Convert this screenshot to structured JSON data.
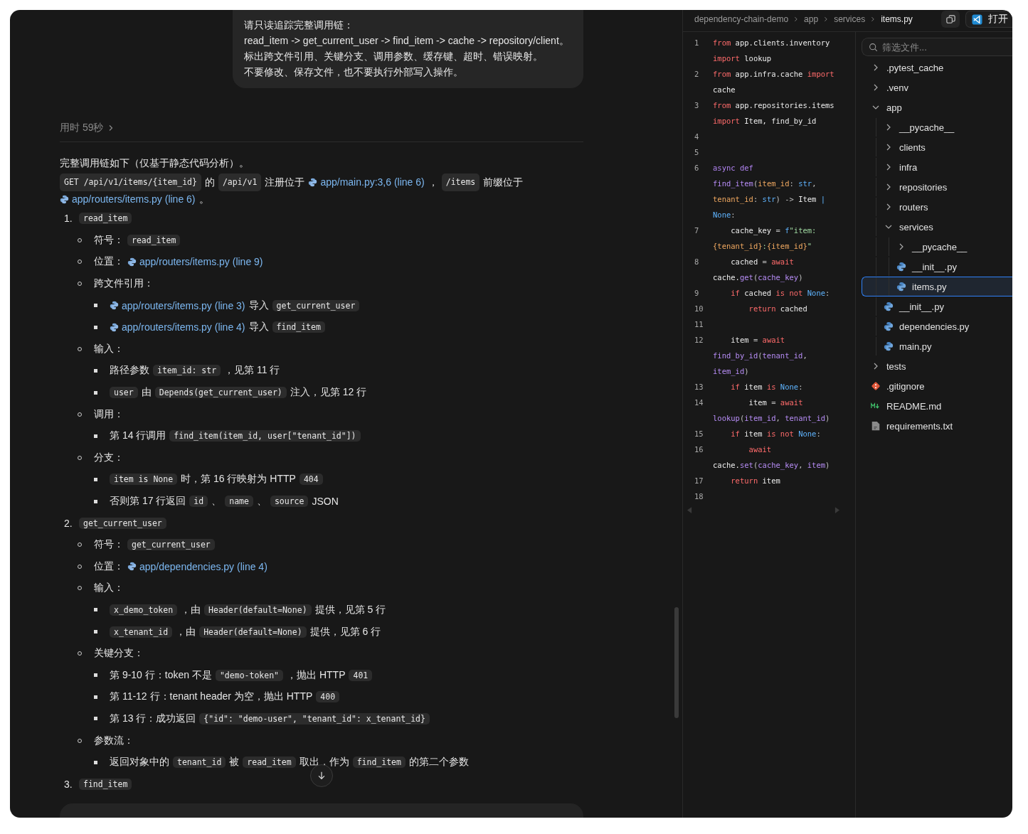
{
  "chat": {
    "user_message": [
      "请只读追踪完整调用链：",
      "read_item -> get_current_user -> find_item -> cache -> repository/client。",
      "标出跨文件引用、关键分支、调用参数、缓存键、超时、错误映射。",
      "不要修改、保存文件，也不要执行外部写入操作。"
    ],
    "elapsed": "用时 59秒",
    "intro": "完整调用链如下（仅基于静态代码分析）。",
    "summary": [
      {
        "kind": "code",
        "text": "GET /api/v1/items/{item_id}"
      },
      {
        "kind": "text",
        "text": "的"
      },
      {
        "kind": "code",
        "text": "/api/v1"
      },
      {
        "kind": "text",
        "text": "注册位于"
      },
      {
        "kind": "link",
        "text": "app/main.py:3,6 (line 6)"
      },
      {
        "kind": "text",
        "text": "，"
      },
      {
        "kind": "code",
        "text": "/items"
      },
      {
        "kind": "text",
        "text": "前缀位于"
      },
      {
        "kind": "link",
        "text": "app/routers/items.py (line 6)"
      },
      {
        "kind": "text",
        "text": "。"
      }
    ],
    "steps": [
      {
        "number": "1.",
        "name": "read_item",
        "items": [
          {
            "segments": [
              {
                "kind": "text",
                "text": "符号："
              },
              {
                "kind": "code",
                "text": "read_item"
              }
            ]
          },
          {
            "segments": [
              {
                "kind": "text",
                "text": "位置："
              },
              {
                "kind": "link",
                "text": "app/routers/items.py (line 9)"
              }
            ]
          },
          {
            "segments": [
              {
                "kind": "text",
                "text": "跨文件引用："
              }
            ],
            "children": [
              {
                "segments": [
                  {
                    "kind": "link",
                    "text": "app/routers/items.py (line 3)"
                  },
                  {
                    "kind": "text",
                    "text": "导入"
                  },
                  {
                    "kind": "code",
                    "text": "get_current_user"
                  }
                ]
              },
              {
                "segments": [
                  {
                    "kind": "link",
                    "text": "app/routers/items.py (line 4)"
                  },
                  {
                    "kind": "text",
                    "text": "导入"
                  },
                  {
                    "kind": "code",
                    "text": "find_item"
                  }
                ]
              }
            ]
          },
          {
            "segments": [
              {
                "kind": "text",
                "text": "输入："
              }
            ],
            "children": [
              {
                "segments": [
                  {
                    "kind": "text",
                    "text": "路径参数"
                  },
                  {
                    "kind": "code",
                    "text": "item_id: str"
                  },
                  {
                    "kind": "text",
                    "text": "，见第 11 行"
                  }
                ]
              },
              {
                "segments": [
                  {
                    "kind": "code",
                    "text": "user"
                  },
                  {
                    "kind": "text",
                    "text": "由"
                  },
                  {
                    "kind": "code",
                    "text": "Depends(get_current_user)"
                  },
                  {
                    "kind": "text",
                    "text": "注入，见第 12 行"
                  }
                ]
              }
            ]
          },
          {
            "segments": [
              {
                "kind": "text",
                "text": "调用："
              }
            ],
            "children": [
              {
                "segments": [
                  {
                    "kind": "text",
                    "text": "第 14 行调用"
                  },
                  {
                    "kind": "code",
                    "text": "find_item(item_id, user[\"tenant_id\"])"
                  }
                ]
              }
            ]
          },
          {
            "segments": [
              {
                "kind": "text",
                "text": "分支："
              }
            ],
            "children": [
              {
                "segments": [
                  {
                    "kind": "code",
                    "text": "item is None"
                  },
                  {
                    "kind": "text",
                    "text": "时，第 16 行映射为 HTTP"
                  },
                  {
                    "kind": "code",
                    "text": "404"
                  }
                ]
              },
              {
                "segments": [
                  {
                    "kind": "text",
                    "text": "否则第 17 行返回"
                  },
                  {
                    "kind": "code",
                    "text": "id"
                  },
                  {
                    "kind": "text",
                    "text": "、"
                  },
                  {
                    "kind": "code",
                    "text": "name"
                  },
                  {
                    "kind": "text",
                    "text": "、"
                  },
                  {
                    "kind": "code",
                    "text": "source"
                  },
                  {
                    "kind": "text",
                    "text": "JSON"
                  }
                ]
              }
            ]
          }
        ]
      },
      {
        "number": "2.",
        "name": "get_current_user",
        "items": [
          {
            "segments": [
              {
                "kind": "text",
                "text": "符号："
              },
              {
                "kind": "code",
                "text": "get_current_user"
              }
            ]
          },
          {
            "segments": [
              {
                "kind": "text",
                "text": "位置："
              },
              {
                "kind": "link",
                "text": "app/dependencies.py (line 4)"
              }
            ]
          },
          {
            "segments": [
              {
                "kind": "text",
                "text": "输入："
              }
            ],
            "children": [
              {
                "segments": [
                  {
                    "kind": "code",
                    "text": "x_demo_token"
                  },
                  {
                    "kind": "text",
                    "text": "，由"
                  },
                  {
                    "kind": "code",
                    "text": "Header(default=None)"
                  },
                  {
                    "kind": "text",
                    "text": "提供，见第 5 行"
                  }
                ]
              },
              {
                "segments": [
                  {
                    "kind": "code",
                    "text": "x_tenant_id"
                  },
                  {
                    "kind": "text",
                    "text": "，由"
                  },
                  {
                    "kind": "code",
                    "text": "Header(default=None)"
                  },
                  {
                    "kind": "text",
                    "text": "提供，见第 6 行"
                  }
                ]
              }
            ]
          },
          {
            "segments": [
              {
                "kind": "text",
                "text": "关键分支："
              }
            ],
            "children": [
              {
                "segments": [
                  {
                    "kind": "text",
                    "text": "第 9-10 行：token 不是"
                  },
                  {
                    "kind": "code",
                    "text": "\"demo-token\""
                  },
                  {
                    "kind": "text",
                    "text": "，抛出 HTTP"
                  },
                  {
                    "kind": "code",
                    "text": "401"
                  }
                ]
              },
              {
                "segments": [
                  {
                    "kind": "text",
                    "text": "第 11-12 行：tenant header 为空，抛出 HTTP"
                  },
                  {
                    "kind": "code",
                    "text": "400"
                  }
                ]
              },
              {
                "segments": [
                  {
                    "kind": "text",
                    "text": "第 13 行：成功返回"
                  },
                  {
                    "kind": "code",
                    "text": "{\"id\": \"demo-user\", \"tenant_id\": x_tenant_id}"
                  }
                ]
              }
            ]
          },
          {
            "segments": [
              {
                "kind": "text",
                "text": "参数流："
              }
            ],
            "children": [
              {
                "segments": [
                  {
                    "kind": "text",
                    "text": "返回对象中的"
                  },
                  {
                    "kind": "code",
                    "text": "tenant_id"
                  },
                  {
                    "kind": "text",
                    "text": "被"
                  },
                  {
                    "kind": "code",
                    "text": "read_item"
                  },
                  {
                    "kind": "text",
                    "text": "取出，作为"
                  },
                  {
                    "kind": "code",
                    "text": "find_item"
                  },
                  {
                    "kind": "text",
                    "text": "的第二个参数"
                  }
                ]
              }
            ]
          }
        ]
      },
      {
        "number": "3.",
        "name": "find_item"
      }
    ]
  },
  "editor": {
    "breadcrumb": [
      "dependency-chain-demo",
      "app",
      "services",
      "items.py"
    ],
    "open_button": "打开",
    "lines": [
      {
        "number": "1",
        "rows": [
          {
            "tokens": [
              {
                "kind": "kw",
                "text": "from"
              },
              {
                "kind": "plain",
                "text": " app.clients.inventory"
              }
            ]
          },
          {
            "tokens": [
              {
                "kind": "kw",
                "text": "import"
              },
              {
                "kind": "plain",
                "text": " lookup"
              }
            ]
          }
        ]
      },
      {
        "number": "2",
        "rows": [
          {
            "tokens": [
              {
                "kind": "kw",
                "text": "from"
              },
              {
                "kind": "plain",
                "text": " app.infra.cache "
              },
              {
                "kind": "kw",
                "text": "import"
              }
            ]
          },
          {
            "tokens": [
              {
                "kind": "plain",
                "text": "cache"
              }
            ]
          }
        ]
      },
      {
        "number": "3",
        "rows": [
          {
            "tokens": [
              {
                "kind": "kw",
                "text": "from"
              },
              {
                "kind": "plain",
                "text": " app.repositories.items"
              }
            ]
          },
          {
            "tokens": [
              {
                "kind": "kw",
                "text": "import"
              },
              {
                "kind": "plain",
                "text": " Item, find_by_id"
              }
            ]
          }
        ]
      },
      {
        "number": "4"
      },
      {
        "number": "5"
      },
      {
        "number": "6",
        "rows": [
          {
            "tokens": [
              {
                "kind": "decl",
                "text": "async def"
              }
            ]
          },
          {
            "tokens": [
              {
                "kind": "fn",
                "text": "find_item"
              },
              {
                "kind": "punct",
                "text": "("
              },
              {
                "kind": "param",
                "text": "item_id"
              },
              {
                "kind": "punct",
                "text": ": "
              },
              {
                "kind": "type",
                "text": "str"
              },
              {
                "kind": "punct",
                "text": ","
              }
            ]
          },
          {
            "tokens": [
              {
                "kind": "param",
                "text": "tenant_id"
              },
              {
                "kind": "punct",
                "text": ": "
              },
              {
                "kind": "type",
                "text": "str"
              },
              {
                "kind": "punct",
                "text": ") -> "
              },
              {
                "kind": "plain",
                "text": "Item"
              },
              {
                "kind": "type",
                "text": " |"
              }
            ]
          },
          {
            "tokens": [
              {
                "kind": "type",
                "text": "None"
              },
              {
                "kind": "punct",
                "text": ":"
              }
            ]
          }
        ]
      },
      {
        "number": "7",
        "rows": [
          {
            "tokens": [
              {
                "kind": "plain",
                "text": "    cache_key "
              },
              {
                "kind": "punct",
                "text": "= "
              },
              {
                "kind": "type",
                "text": "f"
              },
              {
                "kind": "str",
                "text": "\"item:"
              }
            ]
          },
          {
            "tokens": [
              {
                "kind": "param",
                "text": "{tenant_id}"
              },
              {
                "kind": "str",
                "text": ":"
              },
              {
                "kind": "param",
                "text": "{item_id}"
              },
              {
                "kind": "str",
                "text": "\""
              }
            ]
          }
        ]
      },
      {
        "number": "8",
        "rows": [
          {
            "tokens": [
              {
                "kind": "plain",
                "text": "    cached "
              },
              {
                "kind": "punct",
                "text": "= "
              },
              {
                "kind": "kw",
                "text": "await"
              }
            ]
          },
          {
            "tokens": [
              {
                "kind": "plain",
                "text": "cache."
              },
              {
                "kind": "fn",
                "text": "get"
              },
              {
                "kind": "punct",
                "text": "("
              },
              {
                "kind": "fn",
                "text": "cache_key"
              },
              {
                "kind": "punct",
                "text": ")"
              }
            ]
          }
        ]
      },
      {
        "number": "9",
        "rows": [
          {
            "tokens": [
              {
                "kind": "kw",
                "text": "    if"
              },
              {
                "kind": "plain",
                "text": " cached "
              },
              {
                "kind": "kw",
                "text": "is not"
              },
              {
                "kind": "type",
                "text": " None"
              },
              {
                "kind": "punct",
                "text": ":"
              }
            ]
          }
        ]
      },
      {
        "number": "10",
        "rows": [
          {
            "tokens": [
              {
                "kind": "kw",
                "text": "        return"
              },
              {
                "kind": "plain",
                "text": " cached"
              }
            ]
          }
        ]
      },
      {
        "number": "11"
      },
      {
        "number": "12",
        "rows": [
          {
            "tokens": [
              {
                "kind": "plain",
                "text": "    item "
              },
              {
                "kind": "punct",
                "text": "= "
              },
              {
                "kind": "kw",
                "text": "await"
              }
            ]
          },
          {
            "tokens": [
              {
                "kind": "fn",
                "text": "find_by_id"
              },
              {
                "kind": "punct",
                "text": "("
              },
              {
                "kind": "fn",
                "text": "tenant_id"
              },
              {
                "kind": "punct",
                "text": ","
              }
            ]
          },
          {
            "tokens": [
              {
                "kind": "fn",
                "text": "item_id"
              },
              {
                "kind": "punct",
                "text": ")"
              }
            ]
          }
        ]
      },
      {
        "number": "13",
        "rows": [
          {
            "tokens": [
              {
                "kind": "kw",
                "text": "    if"
              },
              {
                "kind": "plain",
                "text": " item "
              },
              {
                "kind": "kw",
                "text": "is"
              },
              {
                "kind": "type",
                "text": " None"
              },
              {
                "kind": "punct",
                "text": ":"
              }
            ]
          }
        ]
      },
      {
        "number": "14",
        "rows": [
          {
            "tokens": [
              {
                "kind": "plain",
                "text": "        item "
              },
              {
                "kind": "punct",
                "text": "= "
              },
              {
                "kind": "kw",
                "text": "await"
              }
            ]
          },
          {
            "tokens": [
              {
                "kind": "fn",
                "text": "lookup"
              },
              {
                "kind": "punct",
                "text": "("
              },
              {
                "kind": "fn",
                "text": "item_id"
              },
              {
                "kind": "punct",
                "text": ", "
              },
              {
                "kind": "fn",
                "text": "tenant_id"
              },
              {
                "kind": "punct",
                "text": ")"
              }
            ]
          }
        ]
      },
      {
        "number": "15",
        "rows": [
          {
            "tokens": [
              {
                "kind": "kw",
                "text": "    if"
              },
              {
                "kind": "plain",
                "text": " item "
              },
              {
                "kind": "kw",
                "text": "is not"
              },
              {
                "kind": "type",
                "text": " None"
              },
              {
                "kind": "punct",
                "text": ":"
              }
            ]
          }
        ]
      },
      {
        "number": "16",
        "rows": [
          {
            "tokens": [
              {
                "kind": "kw",
                "text": "        await"
              }
            ]
          },
          {
            "tokens": [
              {
                "kind": "plain",
                "text": "cache."
              },
              {
                "kind": "fn",
                "text": "set"
              },
              {
                "kind": "punct",
                "text": "("
              },
              {
                "kind": "fn",
                "text": "cache_key"
              },
              {
                "kind": "punct",
                "text": ", "
              },
              {
                "kind": "fn",
                "text": "item"
              },
              {
                "kind": "punct",
                "text": ")"
              }
            ]
          }
        ]
      },
      {
        "number": "17",
        "rows": [
          {
            "tokens": [
              {
                "kind": "kw",
                "text": "    return"
              },
              {
                "kind": "plain",
                "text": " item"
              }
            ]
          }
        ]
      },
      {
        "number": "18"
      }
    ]
  },
  "file_tree": {
    "filter_placeholder": "筛选文件...",
    "items": [
      {
        "kind": "folder",
        "name": ".pytest_cache",
        "expanded": false,
        "selected": false
      },
      {
        "kind": "folder",
        "name": ".venv",
        "expanded": false,
        "selected": false
      },
      {
        "kind": "folder",
        "name": "app",
        "expanded": true,
        "selected": false,
        "children": [
          {
            "kind": "folder",
            "name": "__pycache__",
            "expanded": false,
            "selected": false
          },
          {
            "kind": "folder",
            "name": "clients",
            "expanded": false,
            "selected": false
          },
          {
            "kind": "folder",
            "name": "infra",
            "expanded": false,
            "selected": false
          },
          {
            "kind": "folder",
            "name": "repositories",
            "expanded": false,
            "selected": false
          },
          {
            "kind": "folder",
            "name": "routers",
            "expanded": false,
            "selected": false
          },
          {
            "kind": "folder",
            "name": "services",
            "expanded": true,
            "selected": false,
            "children": [
              {
                "kind": "folder",
                "name": "__pycache__",
                "expanded": false,
                "selected": false
              },
              {
                "kind": "python",
                "name": "__init__.py",
                "selected": false
              },
              {
                "kind": "python",
                "name": "items.py",
                "selected": true
              }
            ]
          },
          {
            "kind": "python",
            "name": "__init__.py",
            "selected": false
          },
          {
            "kind": "python",
            "name": "dependencies.py",
            "selected": false
          },
          {
            "kind": "python",
            "name": "main.py",
            "selected": false
          }
        ]
      },
      {
        "kind": "folder",
        "name": "tests",
        "expanded": false,
        "selected": false
      },
      {
        "kind": "git",
        "name": ".gitignore",
        "selected": false
      },
      {
        "kind": "markdown",
        "name": "README.md",
        "selected": false
      },
      {
        "kind": "text",
        "name": "requirements.txt",
        "selected": false
      }
    ]
  }
}
